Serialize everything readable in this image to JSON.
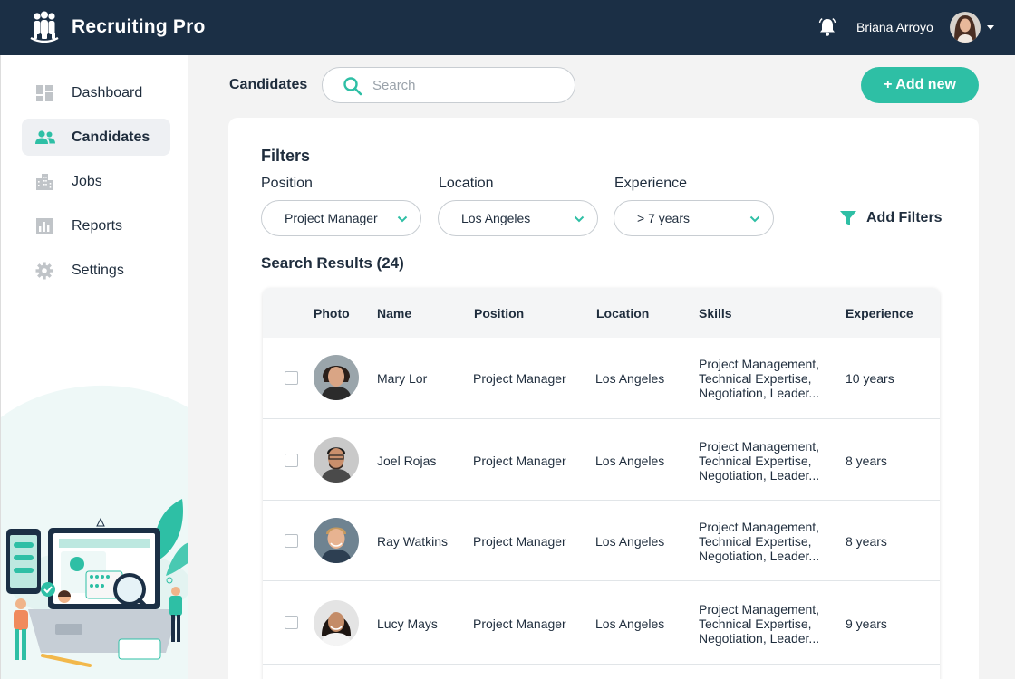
{
  "app": {
    "title": "Recruiting Pro",
    "user_name": "Briana Arroyo",
    "colors": {
      "header": "#1b2f45",
      "accent": "#2ebfa5"
    }
  },
  "sidebar": {
    "items": [
      {
        "label": "Dashboard",
        "icon": "dashboard-icon",
        "active": false
      },
      {
        "label": "Candidates",
        "icon": "users-icon",
        "active": true
      },
      {
        "label": "Jobs",
        "icon": "building-icon",
        "active": false
      },
      {
        "label": "Reports",
        "icon": "bar-chart-icon",
        "active": false
      },
      {
        "label": "Settings",
        "icon": "gear-icon",
        "active": false
      }
    ]
  },
  "header": {
    "breadcrumb": "Candidates",
    "search_placeholder": "Search",
    "add_new_label": "+ Add new"
  },
  "filters": {
    "title": "Filters",
    "position": {
      "label": "Position",
      "value": "Project Manager"
    },
    "location": {
      "label": "Location",
      "value": "Los Angeles"
    },
    "experience": {
      "label": "Experience",
      "value": "> 7 years"
    },
    "add_filters_label": "Add Filters"
  },
  "results": {
    "title": "Search Results (24)",
    "columns": [
      "Photo",
      "Name",
      "Position",
      "Location",
      "Skills",
      "Experience"
    ],
    "rows": [
      {
        "name": "Mary Lor",
        "position": "Project Manager",
        "location": "Los Angeles",
        "skills": [
          "Project Management,",
          "Technical Expertise,",
          "Negotiation, Leader..."
        ],
        "experience": "10 years"
      },
      {
        "name": "Joel Rojas",
        "position": "Project Manager",
        "location": "Los Angeles",
        "skills": [
          "Project Management,",
          "Technical Expertise,",
          "Negotiation, Leader..."
        ],
        "experience": "8 years"
      },
      {
        "name": "Ray Watkins",
        "position": "Project Manager",
        "location": "Los Angeles",
        "skills": [
          "Project Management,",
          "Technical Expertise,",
          "Negotiation, Leader..."
        ],
        "experience": "8 years"
      },
      {
        "name": "Lucy Mays",
        "position": "Project Manager",
        "location": "Los Angeles",
        "skills": [
          "Project Management,",
          "Technical Expertise,",
          "Negotiation, Leader..."
        ],
        "experience": "9 years"
      }
    ]
  }
}
